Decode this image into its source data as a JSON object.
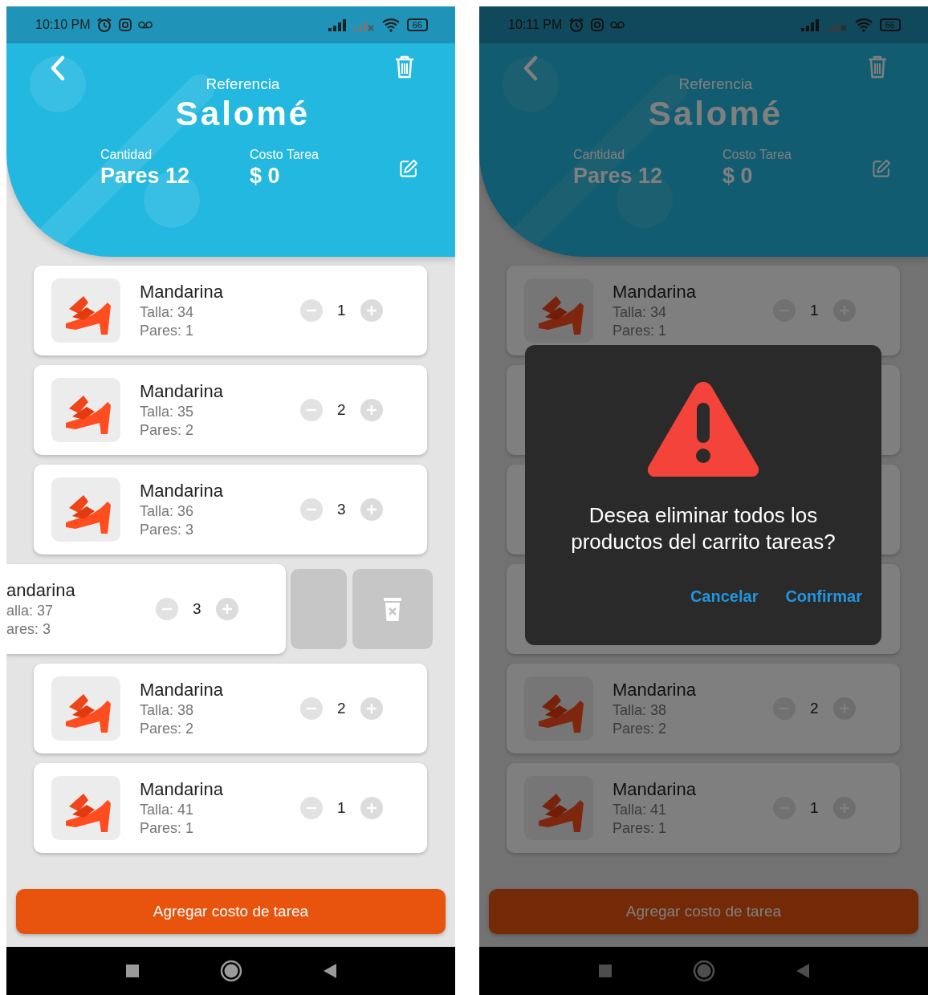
{
  "screens": [
    {
      "status_bar": {
        "time": "10:10 PM",
        "battery": "66"
      },
      "header": {
        "label": "Referencia",
        "title": "Salomé",
        "stats": [
          {
            "label": "Cantidad",
            "value": "Pares 12"
          },
          {
            "label": "Costo Tarea",
            "value": "$ 0"
          }
        ]
      },
      "items": [
        {
          "name": "Mandarina",
          "size": "Talla: 34",
          "pairs": "Pares: 1",
          "quantity": "1",
          "swiped": false
        },
        {
          "name": "Mandarina",
          "size": "Talla: 35",
          "pairs": "Pares: 2",
          "quantity": "2",
          "swiped": false
        },
        {
          "name": "Mandarina",
          "size": "Talla: 36",
          "pairs": "Pares: 3",
          "quantity": "3",
          "swiped": false
        },
        {
          "name": "andarina",
          "size": "alla: 37",
          "pairs": "ares: 3",
          "quantity": "3",
          "swiped": true
        },
        {
          "name": "Mandarina",
          "size": "Talla: 38",
          "pairs": "Pares: 2",
          "quantity": "2",
          "swiped": false
        },
        {
          "name": "Mandarina",
          "size": "Talla: 41",
          "pairs": "Pares: 1",
          "quantity": "1",
          "swiped": false
        }
      ],
      "footer_button": "Agregar costo de tarea",
      "dimmed": false
    },
    {
      "status_bar": {
        "time": "10:11 PM",
        "battery": "66"
      },
      "header": {
        "label": "Referencia",
        "title": "Salomé",
        "stats": [
          {
            "label": "Cantidad",
            "value": "Pares 12"
          },
          {
            "label": "Costo Tarea",
            "value": "$ 0"
          }
        ]
      },
      "items": [
        {
          "name": "Mandarina",
          "size": "Talla: 34",
          "pairs": "Pares: 1",
          "quantity": "1",
          "swiped": false
        },
        {
          "covered": true,
          "swiped": false
        },
        {
          "covered": true,
          "swiped": false
        },
        {
          "covered": true,
          "swiped": false
        },
        {
          "name": "Mandarina",
          "size": "Talla: 38",
          "pairs": "Pares: 2",
          "quantity": "2",
          "swiped": false
        },
        {
          "name": "Mandarina",
          "size": "Talla: 41",
          "pairs": "Pares: 1",
          "quantity": "1",
          "swiped": false
        }
      ],
      "footer_button": "Agregar costo de tarea",
      "dimmed": true,
      "dialog": {
        "message": "Desea eliminar todos los productos del carrito tareas?",
        "buttons": [
          "Cancelar",
          "Confirmar"
        ]
      }
    }
  ]
}
